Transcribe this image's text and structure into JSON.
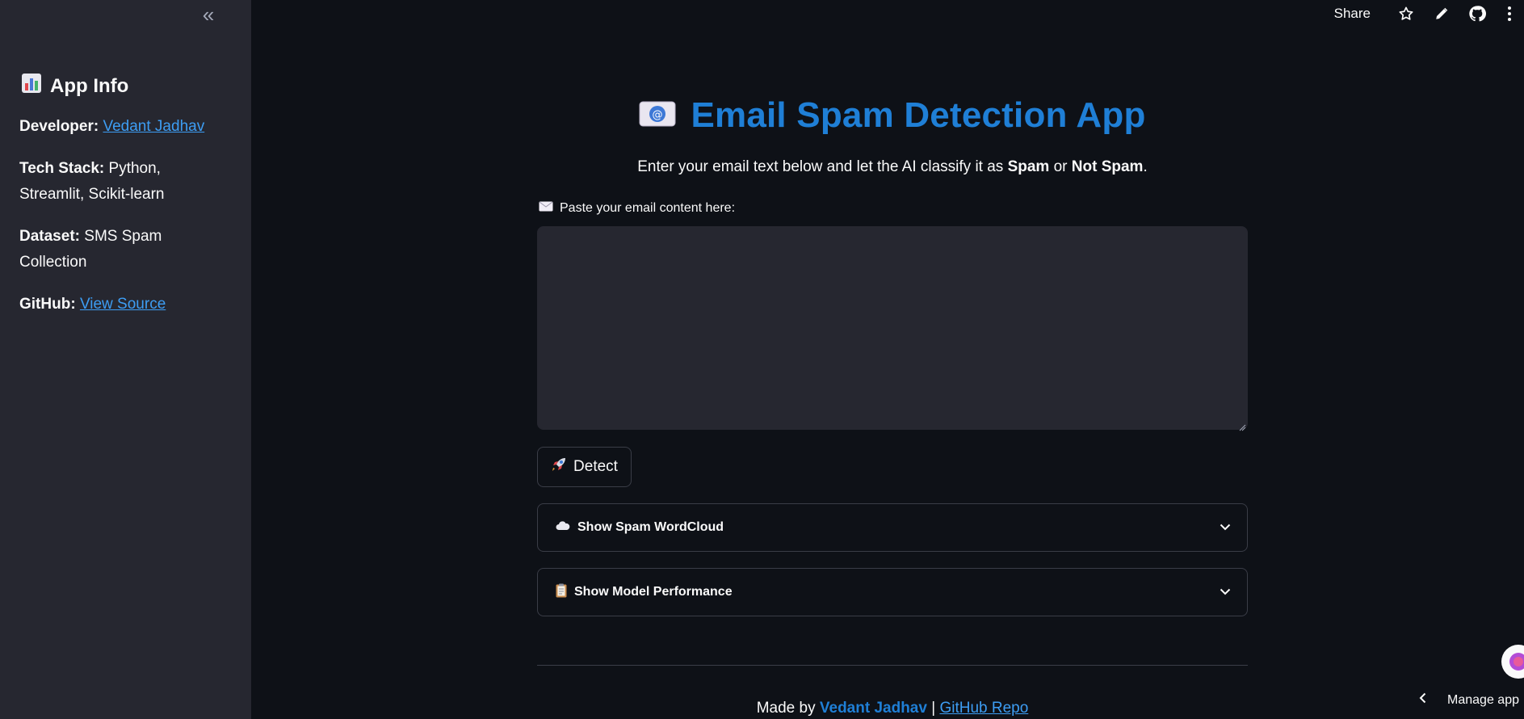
{
  "sidebar": {
    "collapse_glyph": "«",
    "title": "App Info",
    "title_icon": "bar-chart-icon",
    "developer_label": "Developer:",
    "developer_link": "Vedant Jadhav",
    "tech_label": "Tech Stack:",
    "tech_value": "Python, Streamlit, Scikit-learn",
    "dataset_label": "Dataset:",
    "dataset_value": "SMS Spam Collection",
    "github_label": "GitHub:",
    "github_link": "View Source"
  },
  "toolbar": {
    "share_label": "Share",
    "icons": [
      "star-icon",
      "pencil-icon",
      "github-icon",
      "kebab-menu-icon"
    ]
  },
  "main": {
    "title_icon": "email-icon",
    "title": "Email Spam Detection App",
    "subtitle_prefix": "Enter your email text below and let the AI classify it as ",
    "subtitle_spam": "Spam",
    "subtitle_or": " or ",
    "subtitle_not_spam": "Not Spam",
    "subtitle_end": ".",
    "field_label": "Paste your email content here:",
    "field_icon": "envelope-icon",
    "field_value": "",
    "detect_label": "Detect",
    "detect_icon": "rocket-icon",
    "expanders": [
      {
        "label": "Show Spam WordCloud",
        "icon": "cloud-icon"
      },
      {
        "label": "Show Model Performance",
        "icon": "clipboard-icon"
      }
    ],
    "footer_prefix": "Made by ",
    "footer_author": "Vedant Jadhav",
    "footer_sep": " | ",
    "footer_link": "GitHub Repo"
  },
  "manage_app": {
    "label": "Manage app"
  },
  "colors": {
    "background": "#0e1117",
    "sidebar": "#262730",
    "accent_blue": "#1f7fd6",
    "link": "#3d9df3"
  }
}
